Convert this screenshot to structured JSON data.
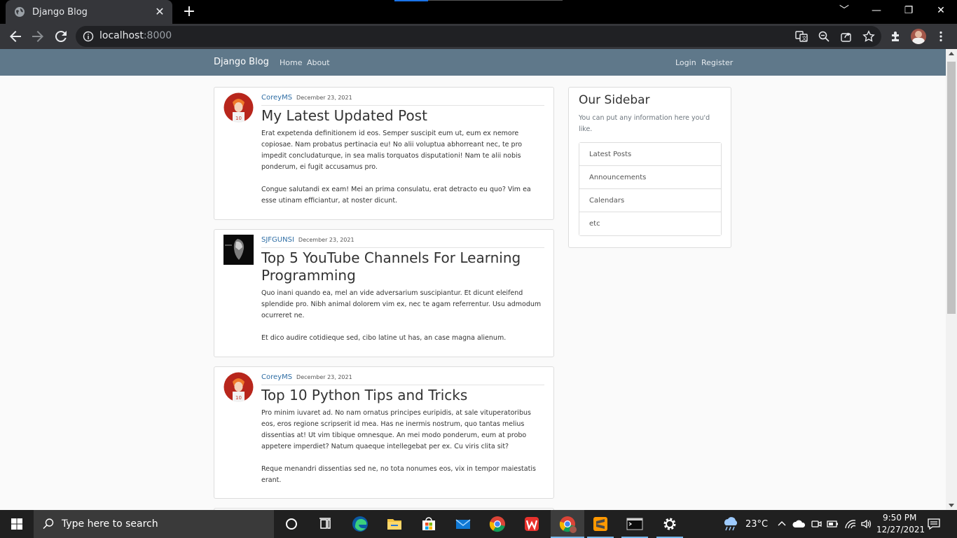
{
  "browser": {
    "tab_title": "Django Blog",
    "new_tab_glyph": "+",
    "close_glyph": "✕",
    "url_host": "localhost",
    "url_port": ":8000",
    "window_controls": [
      "﹀",
      "—",
      "❐",
      "✕"
    ]
  },
  "navbar": {
    "brand": "Django Blog",
    "left_links": [
      "Home",
      "About"
    ],
    "right_links": [
      "Login",
      "Register"
    ],
    "color": "#5f788a"
  },
  "posts": [
    {
      "author": "CoreyMS",
      "date": "December 23, 2021",
      "title": "My Latest Updated Post",
      "paragraphs": [
        "Erat expetenda definitionem id eos. Semper suscipit eum ut, eum ex nemore copiosae. Nam probatus pertinacia eu! No alii voluptua abhorreant nec, te pro impedit concludaturque, in sea malis torquatos disputationi! Nam te alii nobis ponderum, ei fugit accusamus pro.",
        "Congue salutandi ex eam! Mei an prima consulatu, erat detracto eu quo? Vim ea esse utinam efficiantur, at noster dicunt."
      ]
    },
    {
      "author": "SJFGUNSI",
      "date": "December 23, 2021",
      "title": "Top 5 YouTube Channels For Learning Programming",
      "paragraphs": [
        "Quo inani quando ea, mel an vide adversarium suscipiantur. Et dicunt eleifend splendide pro. Nibh animal dolorem vim ex, nec te agam referrentur. Usu admodum ocurreret ne.",
        "Et dico audire cotidieque sed, cibo latine ut has, an case magna alienum."
      ]
    },
    {
      "author": "CoreyMS",
      "date": "December 23, 2021",
      "title": "Top 10 Python Tips and Tricks",
      "paragraphs": [
        "Pro minim iuvaret ad. No nam ornatus principes euripidis, at sale vituperatoribus eos, eros regione scripserit id mea. Has ne inermis nostrum, quo tantas melius dissentias at! Ut vim tibique omnesque. An mei modo ponderum, eum at probo appetere imperdiet? Natum quaeque intellegebat per ex. Cu viris clita sit?",
        "Reque menandri dissentias sed ne, no tota nonumes eos, vix in tempor maiestatis erant."
      ]
    }
  ],
  "sidebar": {
    "title": "Our Sidebar",
    "description": "You can put any information here you'd like.",
    "items": [
      "Latest Posts",
      "Announcements",
      "Calendars",
      "etc"
    ]
  },
  "taskbar": {
    "search_placeholder": "Type here to search",
    "temperature": "23°C",
    "time": "9:50 PM",
    "date": "12/27/2021"
  }
}
